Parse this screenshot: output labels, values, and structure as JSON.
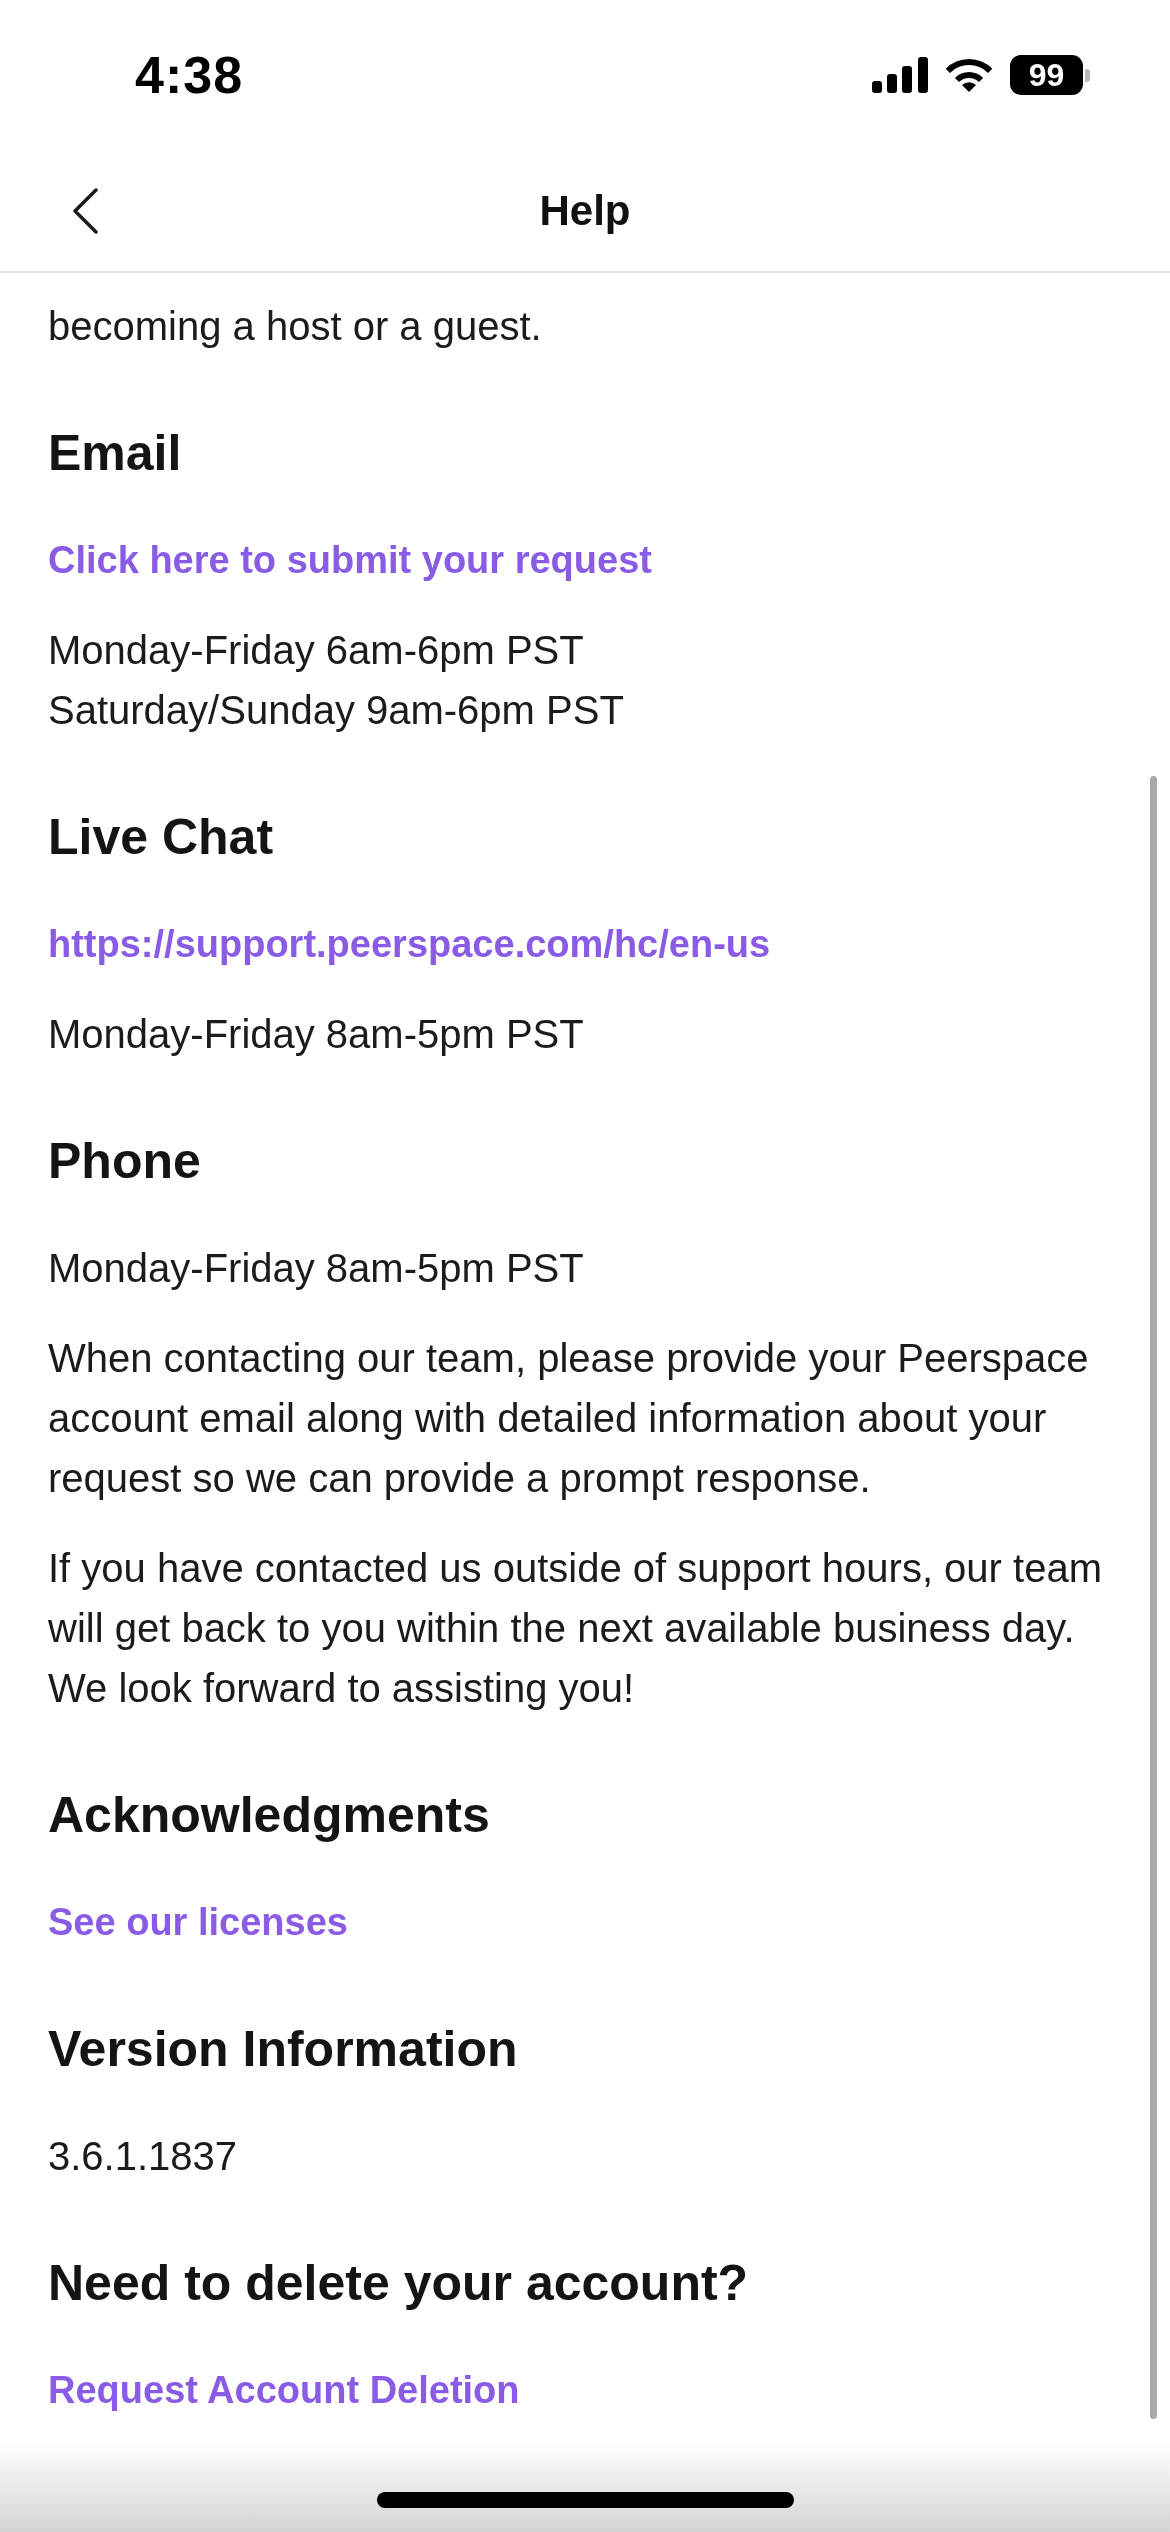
{
  "status_bar": {
    "time": "4:38",
    "battery": "99"
  },
  "header": {
    "title": "Help"
  },
  "intro": "becoming a host or a guest.",
  "sections": [
    {
      "heading": "Email",
      "items": [
        {
          "kind": "link",
          "text": "Click here to submit your request"
        },
        {
          "kind": "text",
          "lines": [
            "Monday-Friday 6am-6pm PST",
            "Saturday/Sunday 9am-6pm PST"
          ]
        }
      ]
    },
    {
      "heading": "Live Chat",
      "items": [
        {
          "kind": "link",
          "text": "https://support.peerspace.com/hc/en-us"
        },
        {
          "kind": "text",
          "lines": [
            "Monday-Friday 8am-5pm PST"
          ]
        }
      ]
    },
    {
      "heading": "Phone",
      "items": [
        {
          "kind": "text",
          "lines": [
            "Monday-Friday 8am-5pm PST"
          ]
        },
        {
          "kind": "text",
          "lines": [
            "When contacting our team, please provide your Peerspace account email along with detailed information about your request so we can provide a prompt response."
          ]
        },
        {
          "kind": "text",
          "lines": [
            "If you have contacted us outside of support hours, our team will get back to you within the next available business day. We look forward to assisting you!"
          ]
        }
      ]
    },
    {
      "heading": "Acknowledgments",
      "items": [
        {
          "kind": "link",
          "text": "See our licenses"
        }
      ]
    },
    {
      "heading": "Version Information",
      "items": [
        {
          "kind": "text",
          "lines": [
            "3.6.1.1837"
          ]
        }
      ]
    },
    {
      "heading": "Need to delete your account?",
      "items": [
        {
          "kind": "link",
          "text": "Request Account Deletion"
        }
      ]
    }
  ]
}
